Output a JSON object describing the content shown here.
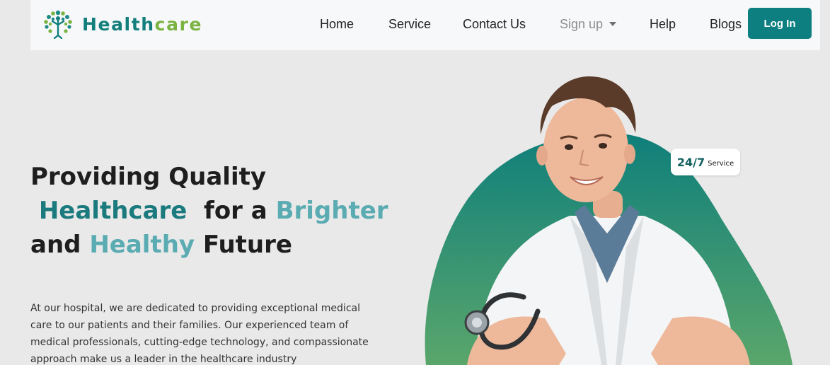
{
  "brand": {
    "name_part1": "Health",
    "name_part2": "care"
  },
  "nav": {
    "home": "Home",
    "service": "Service",
    "contact": "Contact Us",
    "signup": "Sign up",
    "help": "Help",
    "blogs": "Blogs",
    "login": "Log In"
  },
  "hero": {
    "line1": "Providing Quality",
    "healthcare": "Healthcare",
    "for_a": "for a",
    "brighter": "Brighter",
    "and": "and",
    "healthy": "Healthy",
    "future": "Future",
    "description": "At our hospital, we are dedicated to providing exceptional medical care to our patients and their families. Our experienced team of medical professionals, cutting-edge technology, and compassionate approach make us a leader in the healthcare industry"
  },
  "badge": {
    "main": "24/7",
    "sub": "Service"
  },
  "colors": {
    "accent_teal": "#0d7f80",
    "brand_green": "#7ab342",
    "hero_teal": "#1a7a7d",
    "hero_light": "#5aabb2",
    "blob_top": "#0f7f7b",
    "blob_bottom": "#5aa66b"
  },
  "icons": {
    "logo": "tree-person-logo-icon",
    "dropdown": "caret-down-icon"
  }
}
